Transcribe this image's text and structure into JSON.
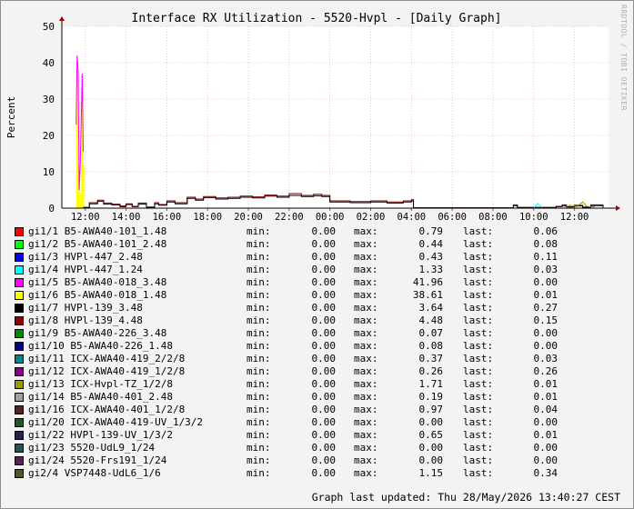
{
  "chart_data": {
    "type": "line",
    "title": "Interface RX Utilization - 5520-Hvpl - [Daily Graph]",
    "ylabel": "Percent",
    "xlabel": "",
    "ylim": [
      0,
      50
    ],
    "yticks": [
      0,
      10,
      20,
      30,
      40,
      50
    ],
    "xlim": [
      10.85,
      13.67
    ],
    "x_unit": "hour of day (Wed 27 May 10:51 to Thu 28 May 13:40 CEST, values above 24 are the following day)",
    "xticks": [
      {
        "hour": 12,
        "label": "12:00"
      },
      {
        "hour": 14,
        "label": "14:00"
      },
      {
        "hour": 16,
        "label": "16:00"
      },
      {
        "hour": 18,
        "label": "18:00"
      },
      {
        "hour": 20,
        "label": "20:00"
      },
      {
        "hour": 22,
        "label": "22:00"
      },
      {
        "hour": 24,
        "label": "00:00"
      },
      {
        "hour": 26,
        "label": "02:00"
      },
      {
        "hour": 28,
        "label": "04:00"
      },
      {
        "hour": 30,
        "label": "06:00"
      },
      {
        "hour": 32,
        "label": "08:00"
      },
      {
        "hour": 34,
        "label": "10:00"
      },
      {
        "hour": 36,
        "label": "12:00"
      }
    ],
    "grid": true,
    "legend_position": "below",
    "series_plotted": [
      {
        "name": "gi1/6 B5-AWA40-018_1.48",
        "color": "#ffff00",
        "style": "area",
        "points": [
          [
            11.6,
            38.6
          ],
          [
            11.65,
            10
          ],
          [
            11.7,
            12
          ],
          [
            11.8,
            4
          ],
          [
            11.85,
            36.5
          ],
          [
            11.9,
            12
          ]
        ]
      },
      {
        "name": "gi1/5 B5-AWA40-018_3.48",
        "color": "#ff00ff",
        "style": "line",
        "points": [
          [
            11.55,
            23
          ],
          [
            11.6,
            42
          ],
          [
            11.65,
            38
          ],
          [
            11.7,
            5
          ],
          [
            11.75,
            11.5
          ],
          [
            11.85,
            37
          ],
          [
            11.9,
            15.5
          ]
        ]
      },
      {
        "name": "gi1/8 HVPl-139_4.48",
        "color": "#800000",
        "style": "step",
        "points": [
          [
            11.9,
            0.2
          ],
          [
            12.2,
            1.5
          ],
          [
            12.6,
            2.2
          ],
          [
            12.9,
            1.4
          ],
          [
            13.3,
            1.1
          ],
          [
            13.7,
            0.6
          ],
          [
            14.0,
            1.2
          ],
          [
            14.3,
            0.5
          ],
          [
            14.6,
            1.4
          ],
          [
            15.0,
            0.3
          ],
          [
            15.4,
            1.5
          ],
          [
            15.6,
            1.0
          ],
          [
            16.0,
            2.0
          ],
          [
            16.4,
            1.5
          ],
          [
            17.0,
            3.0
          ],
          [
            17.4,
            2.5
          ],
          [
            17.8,
            3.2
          ],
          [
            18.4,
            2.8
          ],
          [
            19.0,
            3.0
          ],
          [
            19.6,
            3.3
          ],
          [
            20.2,
            3.1
          ],
          [
            20.8,
            3.6
          ],
          [
            21.4,
            3.3
          ],
          [
            22.0,
            4.0
          ],
          [
            22.6,
            3.5
          ],
          [
            23.2,
            3.8
          ],
          [
            23.6,
            3.5
          ],
          [
            24.0,
            2.0
          ],
          [
            25.0,
            1.8
          ],
          [
            26.0,
            2.0
          ],
          [
            26.8,
            1.7
          ],
          [
            27.6,
            2.0
          ],
          [
            28.0,
            2.3
          ],
          [
            28.1,
            0.1
          ],
          [
            33.0,
            0.9
          ],
          [
            33.2,
            0.2
          ],
          [
            35.1,
            0.5
          ],
          [
            35.4,
            0.9
          ],
          [
            35.6,
            0.4
          ],
          [
            36.0,
            0.8
          ],
          [
            36.4,
            0.3
          ],
          [
            36.8,
            0.9
          ],
          [
            37.4,
            0.2
          ]
        ]
      },
      {
        "name": "gi1/7 HVPl-139_3.48",
        "color": "#000000",
        "style": "step",
        "points": [
          [
            11.9,
            0.2
          ],
          [
            12.2,
            1.2
          ],
          [
            12.6,
            1.9
          ],
          [
            12.9,
            1.1
          ],
          [
            13.3,
            0.9
          ],
          [
            13.7,
            0.4
          ],
          [
            14.0,
            1.0
          ],
          [
            14.3,
            0.4
          ],
          [
            14.6,
            1.1
          ],
          [
            15.0,
            0.2
          ],
          [
            15.4,
            1.2
          ],
          [
            15.6,
            0.8
          ],
          [
            16.0,
            1.7
          ],
          [
            16.4,
            1.2
          ],
          [
            17.0,
            2.7
          ],
          [
            17.4,
            2.2
          ],
          [
            17.8,
            2.9
          ],
          [
            18.4,
            2.5
          ],
          [
            19.0,
            2.7
          ],
          [
            19.6,
            3.0
          ],
          [
            20.2,
            2.8
          ],
          [
            20.8,
            3.3
          ],
          [
            21.4,
            3.0
          ],
          [
            22.0,
            3.5
          ],
          [
            22.6,
            3.2
          ],
          [
            23.2,
            3.4
          ],
          [
            23.6,
            3.2
          ],
          [
            24.0,
            1.7
          ],
          [
            25.0,
            1.5
          ],
          [
            26.0,
            1.7
          ],
          [
            26.8,
            1.4
          ],
          [
            27.6,
            1.7
          ],
          [
            28.0,
            2.0
          ],
          [
            28.1,
            0.1
          ],
          [
            33.0,
            0.7
          ],
          [
            33.2,
            0.2
          ],
          [
            35.1,
            0.4
          ],
          [
            35.4,
            0.7
          ],
          [
            35.6,
            0.3
          ],
          [
            36.0,
            0.6
          ],
          [
            36.4,
            0.2
          ],
          [
            36.8,
            0.7
          ],
          [
            37.4,
            0.2
          ]
        ]
      },
      {
        "name": "gi1/13 ICX-Hvpl-TZ_1/2/8",
        "color": "#999900",
        "style": "line",
        "points": [
          [
            35.5,
            0.3
          ],
          [
            35.8,
            0.8
          ],
          [
            36.1,
            0.4
          ],
          [
            36.4,
            1.7
          ],
          [
            36.6,
            0.5
          ],
          [
            37.0,
            0.3
          ]
        ]
      },
      {
        "name": "gi1/4 HVPl-447_1.24",
        "color": "#00ffff",
        "style": "line",
        "points": [
          [
            34.0,
            0.1
          ],
          [
            34.2,
            1.3
          ],
          [
            34.4,
            0.2
          ]
        ]
      }
    ],
    "legend": {
      "min_label": "min:",
      "max_label": "max:",
      "last_label": "last:",
      "entries": [
        {
          "name": "gi1/1 B5-AWA40-101_1.48",
          "color": "#ff0000",
          "min": "0.00",
          "max": "0.79",
          "last": "0.06"
        },
        {
          "name": "gi1/2 B5-AWA40-101_2.48",
          "color": "#00ff00",
          "min": "0.00",
          "max": "0.44",
          "last": "0.08"
        },
        {
          "name": "gi1/3 HVPl-447_2.48",
          "color": "#0000ff",
          "min": "0.00",
          "max": "0.43",
          "last": "0.11"
        },
        {
          "name": "gi1/4 HVPl-447_1.24",
          "color": "#00ffff",
          "min": "0.00",
          "max": "1.33",
          "last": "0.03"
        },
        {
          "name": "gi1/5 B5-AWA40-018_3.48",
          "color": "#ff00ff",
          "min": "0.00",
          "max": "41.96",
          "last": "0.00"
        },
        {
          "name": "gi1/6 B5-AWA40-018_1.48",
          "color": "#ffff00",
          "min": "0.00",
          "max": "38.61",
          "last": "0.01"
        },
        {
          "name": "gi1/7 HVPl-139_3.48",
          "color": "#000000",
          "min": "0.00",
          "max": "3.64",
          "last": "0.27"
        },
        {
          "name": "gi1/8 HVPl-139_4.48",
          "color": "#990000",
          "min": "0.00",
          "max": "4.48",
          "last": "0.15"
        },
        {
          "name": "gi1/9 B5-AWA40-226_3.48",
          "color": "#008800",
          "min": "0.00",
          "max": "0.07",
          "last": "0.00"
        },
        {
          "name": "gi1/10 B5-AWA40-226_1.48",
          "color": "#000088",
          "min": "0.00",
          "max": "0.08",
          "last": "0.00"
        },
        {
          "name": "gi1/11 ICX-AWA40-419_2/2/8",
          "color": "#008888",
          "min": "0.00",
          "max": "0.37",
          "last": "0.03"
        },
        {
          "name": "gi1/12 ICX-AWA40-419_1/2/8",
          "color": "#880088",
          "min": "0.00",
          "max": "0.26",
          "last": "0.26"
        },
        {
          "name": "gi1/13 ICX-Hvpl-TZ_1/2/8",
          "color": "#999900",
          "min": "0.00",
          "max": "1.71",
          "last": "0.01"
        },
        {
          "name": "gi1/14 B5-AWA40-401_2.48",
          "color": "#a0a0a0",
          "min": "0.00",
          "max": "0.19",
          "last": "0.01"
        },
        {
          "name": "gi1/16 ICX-AWA40-401_1/2/8",
          "color": "#552222",
          "min": "0.00",
          "max": "0.97",
          "last": "0.04"
        },
        {
          "name": "gi1/20 ICX-AWA40-419-UV_1/3/2",
          "color": "#225522",
          "min": "0.00",
          "max": "0.00",
          "last": "0.00"
        },
        {
          "name": "gi1/22 HVPl-139-UV_1/3/2",
          "color": "#222255",
          "min": "0.00",
          "max": "0.65",
          "last": "0.01"
        },
        {
          "name": "gi1/23 5520-UdL9_1/24",
          "color": "#225555",
          "min": "0.00",
          "max": "0.00",
          "last": "0.00"
        },
        {
          "name": "gi1/24 5520-Frs191_1/24",
          "color": "#552255",
          "min": "0.00",
          "max": "0.00",
          "last": "0.00"
        },
        {
          "name": "gi2/4 VSP7448-UdL6_1/6",
          "color": "#555522",
          "min": "0.00",
          "max": "1.15",
          "last": "0.34"
        }
      ]
    },
    "watermark": "RRDTOOL / TOBI OETIKER",
    "updated": "Graph last updated: Thu 28/May/2026 13:40:27 CEST"
  }
}
